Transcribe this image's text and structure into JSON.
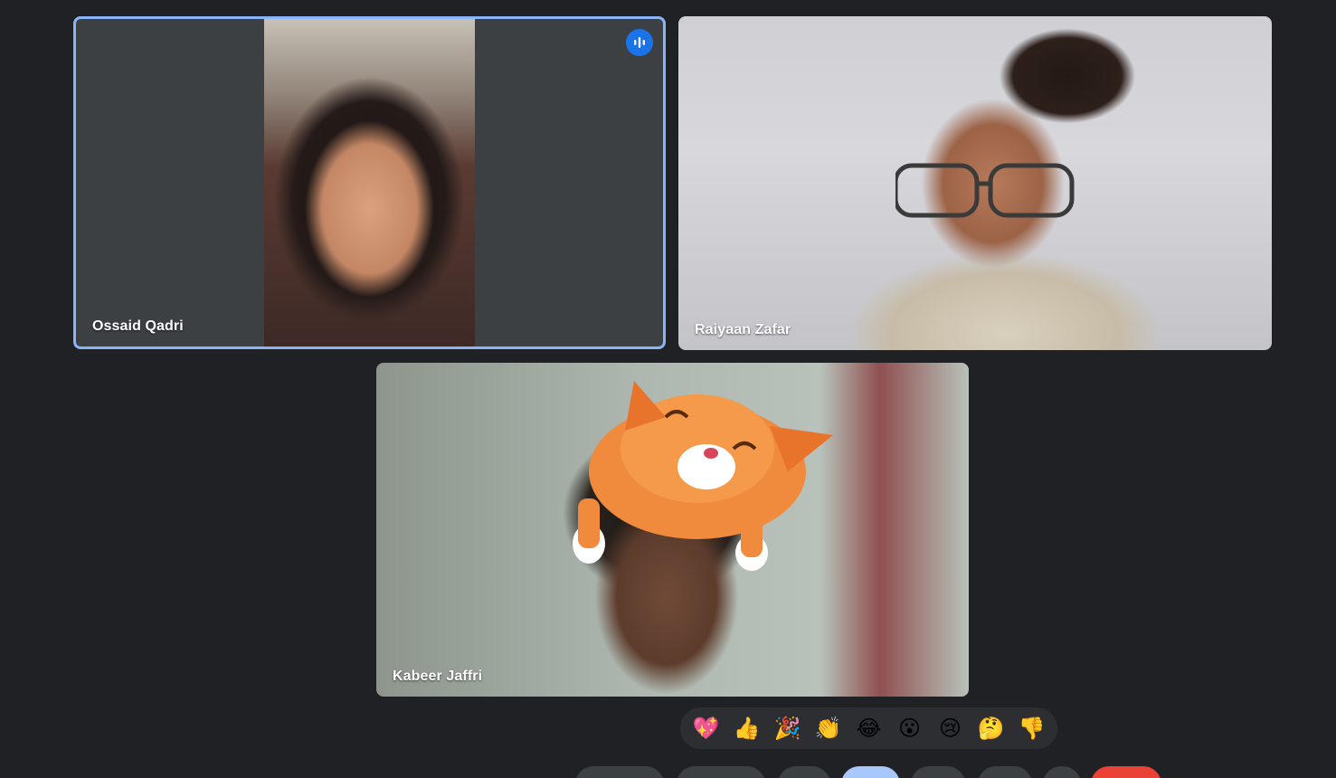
{
  "participants": [
    {
      "name": "Ossaid Qadri",
      "speaking": true
    },
    {
      "name": "Raiyaan Zafar",
      "speaking": false
    },
    {
      "name": "Kabeer Jaffri",
      "speaking": false
    }
  ],
  "reactions": [
    "💖",
    "👍",
    "🎉",
    "👏",
    "😂",
    "😮",
    "😢",
    "🤔",
    "👎"
  ],
  "colors": {
    "background": "#202124",
    "tile": "#3c4043",
    "speaking_border": "#8ab4f8",
    "speaking_indicator": "#1a73e8",
    "leave": "#ea4335",
    "active_control": "#a8c7fa"
  },
  "icons": {
    "speaking": "audio-level-icon"
  }
}
